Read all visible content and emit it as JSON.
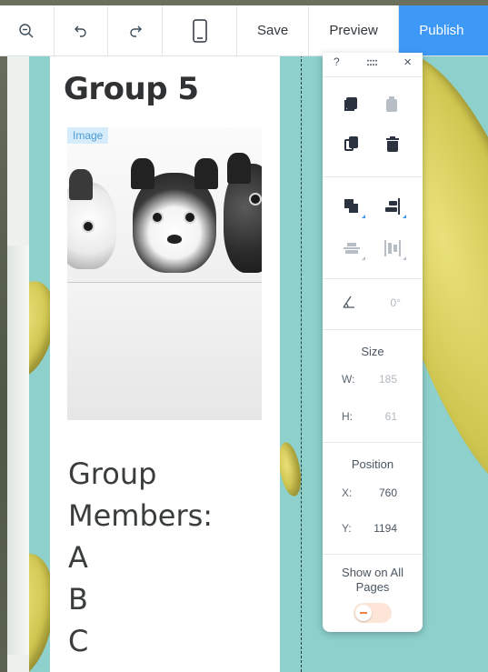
{
  "toolbar": {
    "zoom_out_icon": "zoom-out-icon",
    "undo_icon": "undo-icon",
    "redo_icon": "redo-icon",
    "mobile_icon": "mobile-device-icon",
    "save_label": "Save",
    "preview_label": "Preview",
    "publish_label": "Publish"
  },
  "section": {
    "title": "Group 5",
    "image_tag": "Image",
    "members_lines": [
      "Group",
      "Members:",
      "A",
      "B",
      "C"
    ]
  },
  "panel": {
    "help": "?",
    "drag": "::::",
    "close": "×",
    "rotate_value": "0°",
    "size_label": "Size",
    "width_key": "W:",
    "width_value": "185",
    "height_key": "H:",
    "height_value": "61",
    "position_label": "Position",
    "x_key": "X:",
    "x_value": "760",
    "y_key": "Y:",
    "y_value": "1194",
    "show_on_all_pages_line1": "Show on All",
    "show_on_all_pages_line2": "Pages",
    "show_on_all_pages_enabled": false
  },
  "colors": {
    "canvas_bg": "#8dd0cc",
    "publish_bg": "#3d99f5",
    "toggle_off_bg": "#fde6d7",
    "toggle_accent": "#f08040"
  }
}
